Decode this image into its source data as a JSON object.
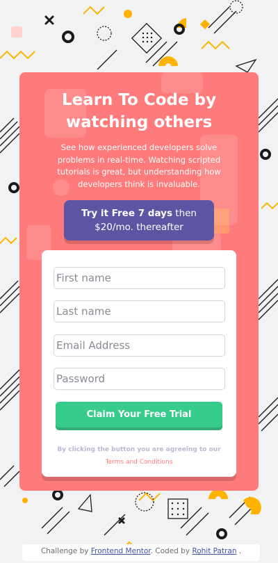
{
  "hero": {
    "title": "Learn To Code by watching others",
    "description": "See how experienced developers solve problems in real-time. Watching scripted tutorials is great, but understanding how developers think is invaluable."
  },
  "promo": {
    "bold": "Try it Free 7 days",
    "rest": " then $20/mo. thereafter"
  },
  "form": {
    "first_name_placeholder": "First name",
    "last_name_placeholder": "Last name",
    "email_placeholder": "Email Address",
    "password_placeholder": "Password",
    "submit_label": "Claim Your Free Trial",
    "terms_prefix": "By clicking the button you are agreeing to our",
    "terms_link": "Terms and Conditions"
  },
  "attribution": {
    "prefix": "Challenge by ",
    "link1": "Frontend Mentor",
    "middle": ". Coded by ",
    "link2": "Rohit Patran",
    "suffix": " ."
  },
  "colors": {
    "background": "#f2f2f2",
    "card": "#ff7a7a",
    "promo": "#5e54a4",
    "button": "#38cc8c",
    "accent_yellow": "#ffb300"
  }
}
